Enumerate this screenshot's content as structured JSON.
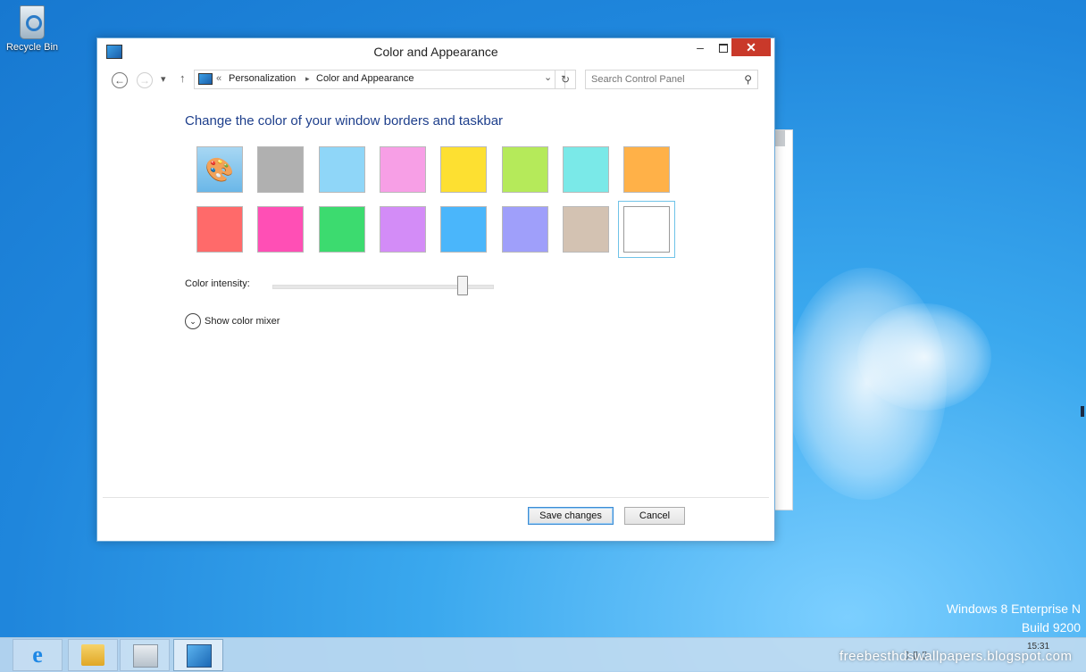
{
  "desktop": {
    "recycle_bin_label": "Recycle Bin",
    "os_edition": "Windows 8 Enterprise N",
    "os_build": "Build 9200",
    "watermark": "freebesthdswallpapers.blogspot.com"
  },
  "window": {
    "title": "Color and Appearance",
    "controls": {
      "minimize": "–",
      "close": "✕"
    },
    "nav": {
      "back": "←",
      "forward": "→",
      "recent": "▾",
      "up": "↑",
      "breadcrumb_prefix": "«",
      "breadcrumbs": [
        "Personalization",
        "Color and Appearance"
      ],
      "separator": "▸",
      "dropdown": "⌄",
      "refresh": "↻"
    },
    "search": {
      "placeholder": "Search Control Panel",
      "icon": "search-icon"
    },
    "heading": "Change the color of your window borders and taskbar",
    "swatches": {
      "row1": [
        "auto",
        "#b0b0b0",
        "#8fd6f8",
        "#f79fe6",
        "#fde031",
        "#b5ea5a",
        "#7ae9e8",
        "#ffb148"
      ],
      "row2": [
        "#ff6a6a",
        "#ff4fb5",
        "#3cdb6f",
        "#d38cf7",
        "#4ab6fb",
        "#9f9ffa",
        "#d3c2b2",
        "#ffffff"
      ],
      "selected_index": 15
    },
    "intensity": {
      "label": "Color intensity:",
      "value_fraction": 0.86
    },
    "mixer_label": "Show color mixer",
    "buttons": {
      "save": "Save changes",
      "cancel": "Cancel"
    }
  },
  "taskbar": {
    "apps": [
      "internet-explorer-icon",
      "file-explorer-icon",
      "store-icon",
      "control-panel-icon"
    ],
    "time": "15:31"
  }
}
